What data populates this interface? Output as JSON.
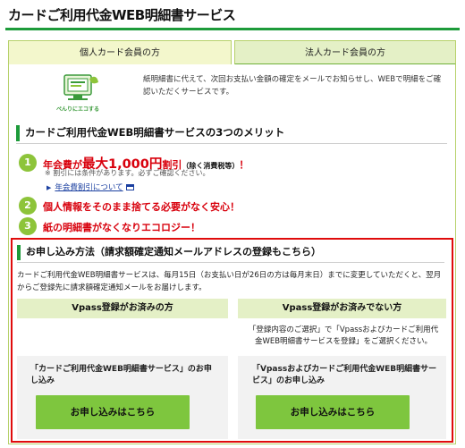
{
  "page": {
    "title": "カードご利用代金WEB明細書サービス"
  },
  "tabs": [
    {
      "label": "個人カード会員の方",
      "active": true
    },
    {
      "label": "法人カード会員の方",
      "active": false
    }
  ],
  "intro": {
    "image_caption": "ぺんりにエコする",
    "text": "紙明細書に代えて、次回お支払い金額の確定をメールでお知らせし、WEBで明細をご確認いただくサービスです。"
  },
  "merits": {
    "heading": "カードご利用代金WEB明細書サービスの3つのメリット",
    "items": [
      {
        "num": "1",
        "pre": "年会費が",
        "big": "最大1,000円",
        "post": "割引",
        "note": "（除く消費税等）",
        "bang": "！"
      },
      {
        "num": "2",
        "text": "個人情報をそのまま捨てる必要がなく安心！"
      },
      {
        "num": "3",
        "text": "紙の明細書がなくなりエコロジー！"
      }
    ],
    "footnote": "※ 割引には条件があります。必ずご確認ください。",
    "link": "年会費割引について"
  },
  "apply": {
    "heading": "お申し込み方法（請求額確定通知メールアドレスの登録もこちら）",
    "description": "カードご利用代金WEB明細書サービスは、毎月15日（お支払い日が26日の方は毎月末日）までに変更していただくと、翌月からご登録先に請求額確定通知メールをお届けします。",
    "left": {
      "header": "Vpass登録がお済みの方",
      "card_text": "「カードご利用代金WEB明細書サービス」のお申し込み",
      "button": "お申し込みはこちら"
    },
    "right": {
      "header": "Vpass登録がお済みでない方",
      "desc": "「登録内容のご選択」で「Vpassおよびカードご利用代金WEB明細書サービスを登録」をご選択ください。",
      "card_text": "「Vpassおよびカードご利用代金WEB明細書サービス」のお申し込み",
      "button": "お申し込みはこちら"
    }
  },
  "colors": {
    "green": "#1d9b3a",
    "light_green": "#8dc43a",
    "button_green": "#7ec63e",
    "red": "#e00c0c",
    "tab_bg": "#e4f0c6"
  }
}
